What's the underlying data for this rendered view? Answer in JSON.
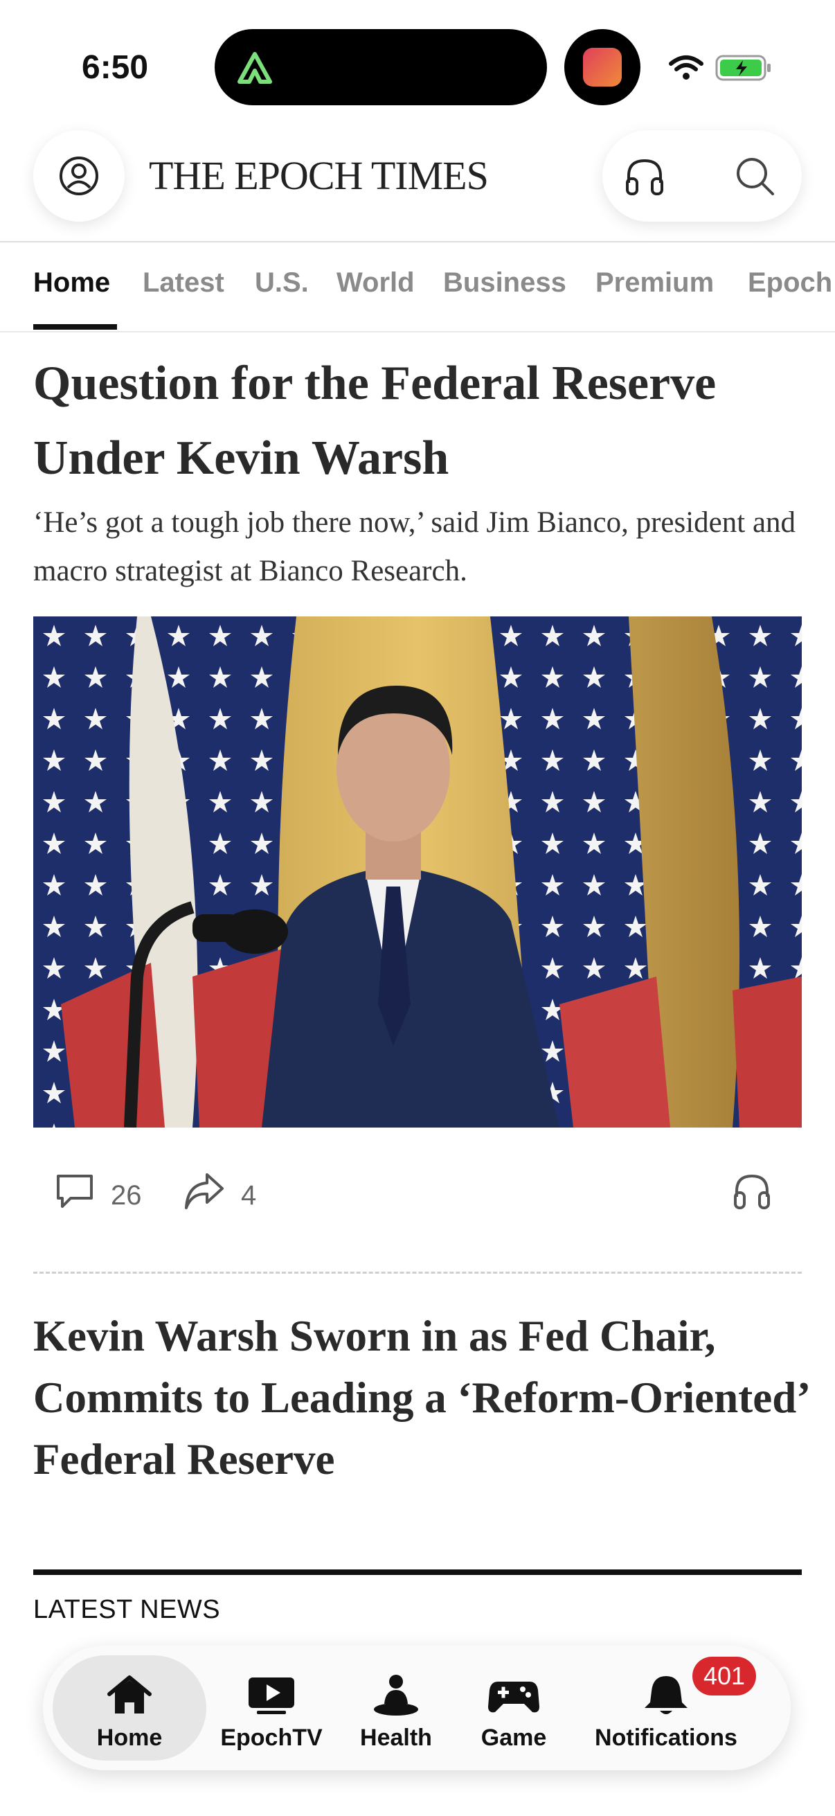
{
  "status_bar": {
    "time": "6:50"
  },
  "header": {
    "logo_text": "THE EPOCH TIMES",
    "profile_icon": "user-circle-icon",
    "audio_icon": "headphones-icon",
    "search_icon": "search-icon"
  },
  "tabs": [
    {
      "label": "Home",
      "active": true
    },
    {
      "label": "Latest",
      "active": false
    },
    {
      "label": "U.S.",
      "active": false
    },
    {
      "label": "World",
      "active": false
    },
    {
      "label": "Business",
      "active": false
    },
    {
      "label": "Premium",
      "active": false
    },
    {
      "label": "Epoch",
      "active": false
    }
  ],
  "lead_article": {
    "headline": "Question for the Federal Reserve Under Kevin Warsh",
    "dek": "‘He’s got a tough job there now,’ said Jim Bianco, president and macro strategist at Bianco Research.",
    "comments": "26",
    "shares": "4"
  },
  "second_article": {
    "headline": "Kevin Warsh Sworn in as Fed Chair, Commits to Leading a ‘Reform-Oriented’ Federal Reserve"
  },
  "section": {
    "label": "LATEST NEWS"
  },
  "bottom_nav": {
    "items": [
      {
        "label": "Home",
        "icon": "home-icon",
        "active": true
      },
      {
        "label": "EpochTV",
        "icon": "play-video-icon",
        "active": false
      },
      {
        "label": "Health",
        "icon": "meditation-icon",
        "active": false
      },
      {
        "label": "Game",
        "icon": "gamepad-icon",
        "active": false
      },
      {
        "label": "Notifications",
        "icon": "bell-icon",
        "active": false
      }
    ],
    "notifications_badge": "401"
  },
  "colors": {
    "accent_badge": "#d9272e",
    "text_primary": "#111111",
    "text_muted": "#8a8a8a"
  }
}
